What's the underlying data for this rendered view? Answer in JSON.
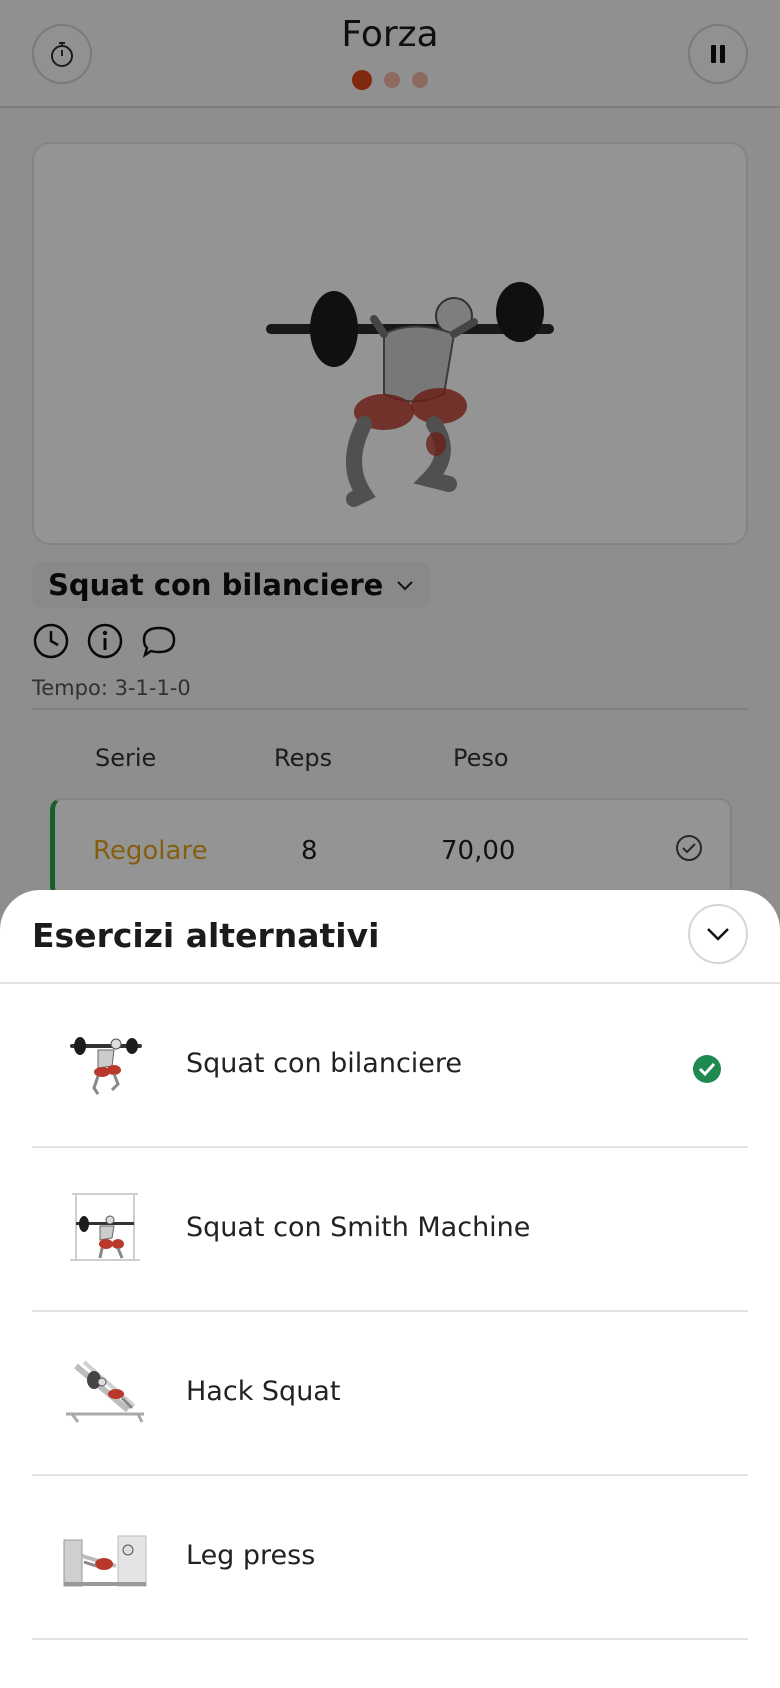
{
  "header": {
    "title": "Forza",
    "page_count": 3,
    "active_page": 1
  },
  "exercise": {
    "name": "Squat con bilanciere",
    "tempo": "Tempo: 3-1-1-0"
  },
  "sets_table": {
    "headers": [
      "Serie",
      "Reps",
      "Peso"
    ],
    "rows": [
      {
        "type": "Regolare",
        "reps": "8",
        "weight": "70,00",
        "done": false
      }
    ]
  },
  "sheet": {
    "title": "Esercizi alternativi",
    "items": [
      {
        "name": "Squat con bilanciere",
        "selected": true,
        "icon": "barbell-squat-thumbnail"
      },
      {
        "name": "Squat con Smith Machine",
        "selected": false,
        "icon": "smith-machine-squat-thumbnail"
      },
      {
        "name": "Hack Squat",
        "selected": false,
        "icon": "hack-squat-thumbnail"
      },
      {
        "name": "Leg press",
        "selected": false,
        "icon": "leg-press-thumbnail"
      }
    ]
  },
  "colors": {
    "accent": "#e0441c",
    "success": "#1e8a4f",
    "set_type": "#e5a21e"
  }
}
